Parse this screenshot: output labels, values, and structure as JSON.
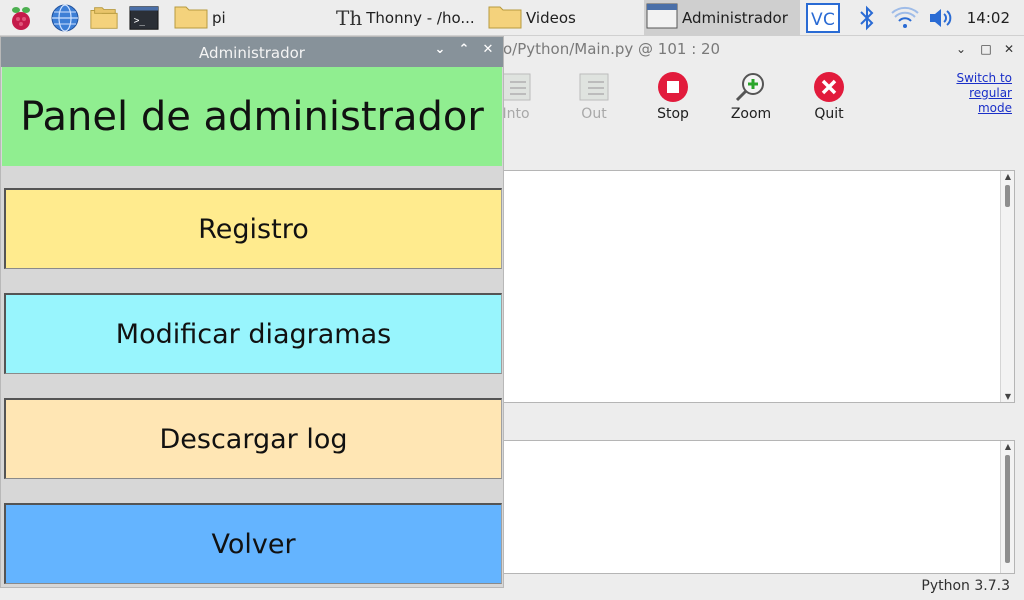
{
  "taskbar": {
    "tasks": [
      {
        "label": "pi",
        "icon": "folder-icon"
      },
      {
        "label": "Thonny  -  /ho...",
        "icon": "thonny-icon"
      },
      {
        "label": "Videos",
        "icon": "folder-icon"
      },
      {
        "label": "Administrador",
        "icon": "window-icon"
      }
    ],
    "launchers": [
      "raspberry-menu-icon",
      "web-browser-icon",
      "file-manager-icon",
      "terminal-icon"
    ],
    "tray": [
      "vnc-icon",
      "bluetooth-icon",
      "wifi-icon",
      "volume-icon"
    ],
    "clock": "14:02"
  },
  "thonny": {
    "title_fragment": "o/Python/Main.py  @  101 : 20",
    "toolbar": [
      {
        "label": "Into",
        "enabled": false
      },
      {
        "label": "Out",
        "enabled": false
      },
      {
        "label": "Stop",
        "enabled": true
      },
      {
        "label": "Zoom",
        "enabled": true
      },
      {
        "label": "Quit",
        "enabled": true
      }
    ],
    "switch_mode": [
      "Switch to",
      "regular",
      "mode"
    ],
    "status": "Python 3.7.3"
  },
  "admin": {
    "title": "Administrador",
    "heading": "Panel de administrador",
    "buttons": [
      {
        "label": "Registro",
        "color": "#ffeb8e"
      },
      {
        "label": "Modificar diagramas",
        "color": "#98f5fd"
      },
      {
        "label": "Descargar log",
        "color": "#ffe6b4"
      },
      {
        "label": "Volver",
        "color": "#64b4ff"
      }
    ],
    "heading_color": "#90ee90"
  }
}
